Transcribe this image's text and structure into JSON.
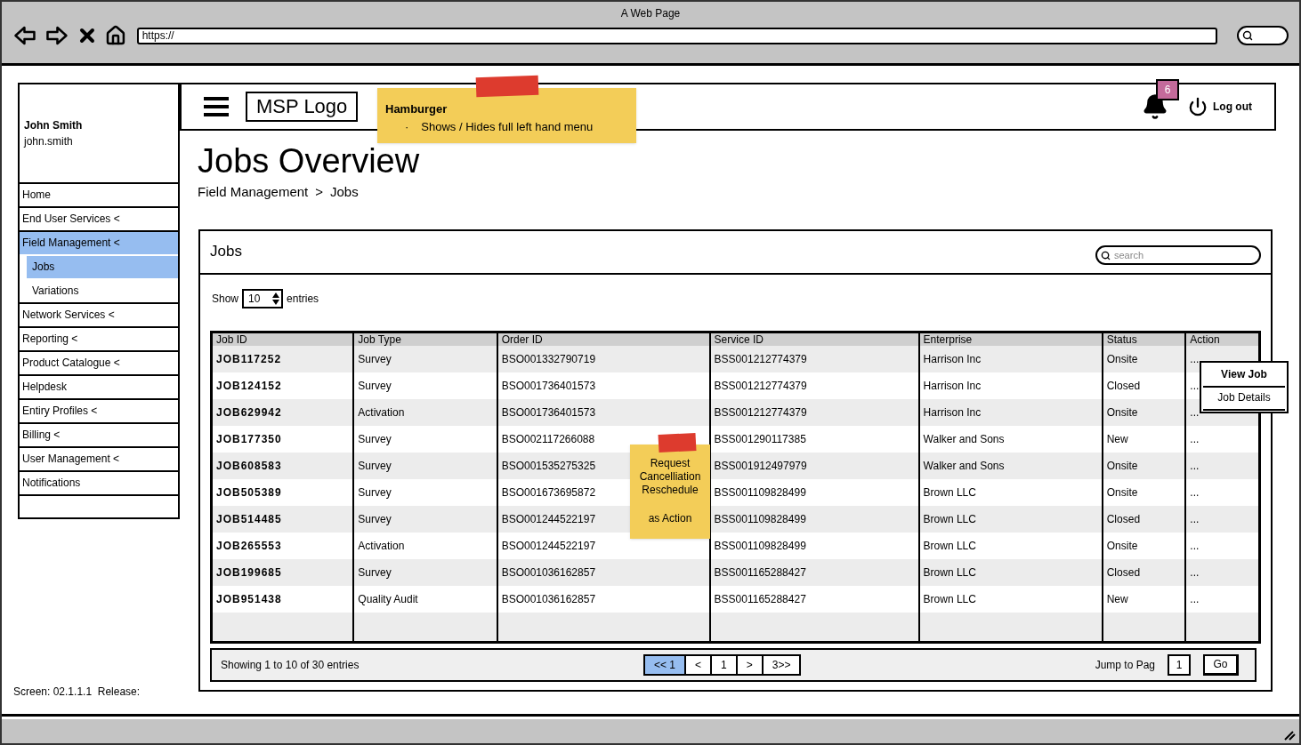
{
  "browser": {
    "title": "A Web Page",
    "url": "https://"
  },
  "user": {
    "name": "John Smith",
    "username": "john.smith"
  },
  "sidebar": {
    "items": [
      {
        "label": "Home",
        "selected": false
      },
      {
        "label": "End User Services <",
        "selected": false
      },
      {
        "label": "Field Management <",
        "selected": true,
        "children": [
          {
            "label": "Jobs",
            "selected": true
          },
          {
            "label": "Variations",
            "selected": false
          }
        ]
      },
      {
        "label": "Network Services <",
        "selected": false
      },
      {
        "label": "Reporting <",
        "selected": false
      },
      {
        "label": "Product Catalogue <",
        "selected": false
      },
      {
        "label": "Helpdesk",
        "selected": false
      },
      {
        "label": "Entiry Profiles <",
        "selected": false
      },
      {
        "label": "Billing <",
        "selected": false
      },
      {
        "label": "User Management <",
        "selected": false
      },
      {
        "label": "Notifications",
        "selected": false
      }
    ]
  },
  "header": {
    "logo": "MSP Logo",
    "notification_count": "6",
    "logout": "Log out"
  },
  "hamburger_note": {
    "title": "Hamburger",
    "bullet_mark": "·",
    "bullets": [
      "Shows / Hides full left hand menu"
    ]
  },
  "page": {
    "title": "Jobs Overview",
    "breadcrumb": [
      "Field Management",
      "Jobs"
    ],
    "breadcrumb_separator": ">"
  },
  "panel": {
    "title": "Jobs",
    "search": {
      "placeholder": "search"
    },
    "show_label": "Show",
    "page_size": "10",
    "entries_label": "entries"
  },
  "table": {
    "columns": [
      "Job ID",
      "Job Type",
      "Order ID",
      "Service ID",
      "Enterprise",
      "Status",
      "Action"
    ],
    "rows": [
      [
        "JOB117252",
        "Survey",
        "BSO001332790719",
        "BSS001212774379",
        "Harrison Inc",
        "Onsite",
        "..."
      ],
      [
        "JOB124152",
        "Survey",
        "BSO001736401573",
        "BSS001212774379",
        "Harrison Inc",
        "Closed",
        "..."
      ],
      [
        "JOB629942",
        "Activation",
        "BSO001736401573",
        "BSS001212774379",
        "Harrison Inc",
        "Onsite",
        "..."
      ],
      [
        "JOB177350",
        "Survey",
        "BSO002117266088",
        "BSS001290117385",
        "Walker and Sons",
        "New",
        "..."
      ],
      [
        "JOB608583",
        "Survey",
        "BSO001535275325",
        "BSS001912497979",
        "Walker and Sons",
        "Onsite",
        "..."
      ],
      [
        "JOB505389",
        "Survey",
        "BSO001673695872",
        "BSS001109828499",
        "Brown LLC",
        "Onsite",
        "..."
      ],
      [
        "JOB514485",
        "Survey",
        "BSO001244522197",
        "BSS001109828499",
        "Brown LLC",
        "Closed",
        "..."
      ],
      [
        "JOB265553",
        "Activation",
        "BSO001244522197",
        "BSS001109828499",
        "Brown LLC",
        "Onsite",
        "..."
      ],
      [
        "JOB199685",
        "Survey",
        "BSO001036162857",
        "BSS001165288427",
        "Brown LLC",
        "Closed",
        "..."
      ],
      [
        "JOB951438",
        "Quality Audit",
        "BSO001036162857",
        "BSS001165288427",
        "Brown LLC",
        "New",
        "..."
      ]
    ]
  },
  "action_menu": {
    "title": "View Job",
    "items": [
      "Job Details"
    ]
  },
  "action_note": {
    "lines": [
      "Request",
      "Cancelliation",
      "Reschedule",
      "as Action"
    ]
  },
  "pagination": {
    "summary": "Showing 1 to 10 of 30 entries",
    "pages": [
      {
        "label": "<< 1",
        "selected": true
      },
      {
        "label": "<",
        "selected": false
      },
      {
        "label": "1",
        "selected": false
      },
      {
        "label": ">",
        "selected": false
      },
      {
        "label": "3>>",
        "selected": false
      }
    ],
    "jump_label": "Jump to Pag",
    "jump_value": "1",
    "go": "Go"
  },
  "footer": "Screen: 02.1.1.1  Release:"
}
